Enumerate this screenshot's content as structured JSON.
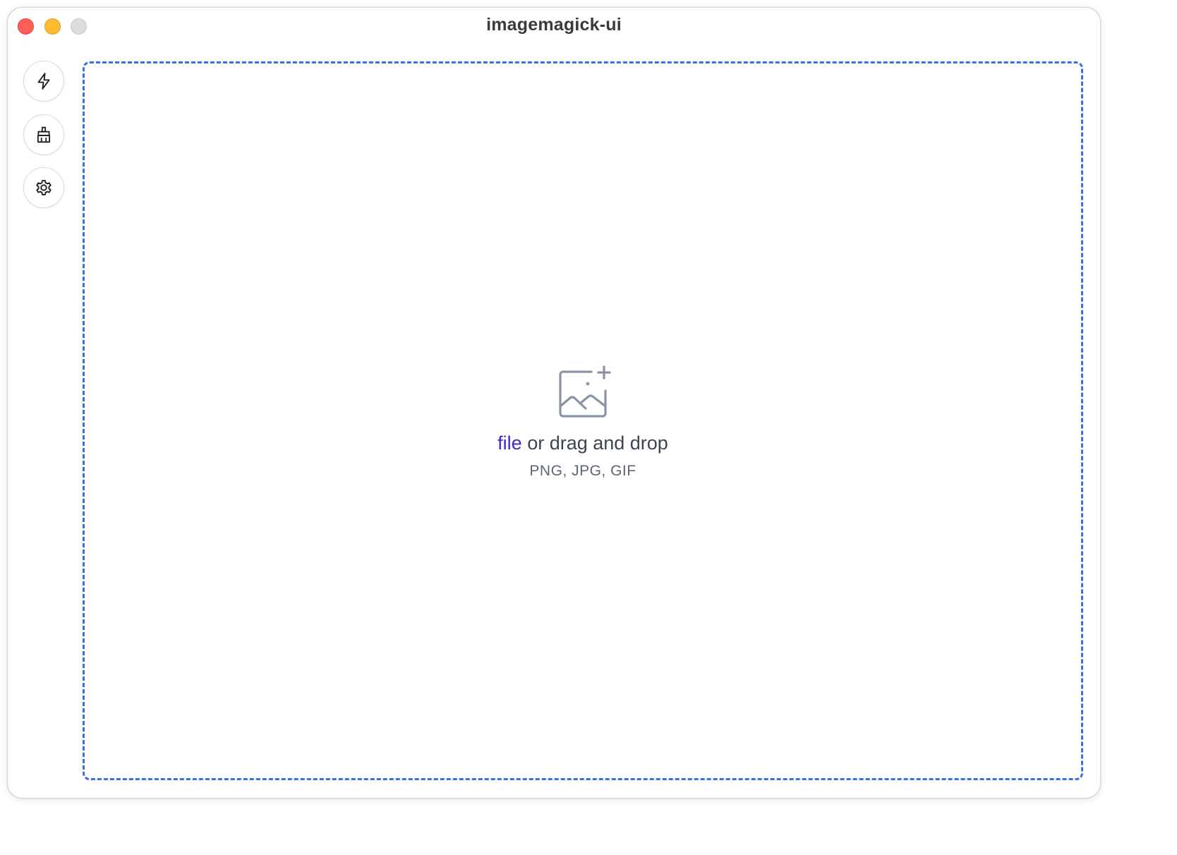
{
  "window": {
    "title": "imagemagick-ui"
  },
  "sidebar": {
    "buttons": [
      {
        "icon": "lightning-bolt-icon"
      },
      {
        "icon": "broom-icon"
      },
      {
        "icon": "gear-icon"
      }
    ]
  },
  "dropzone": {
    "link_label": "file",
    "prompt_rest": " or drag and drop",
    "formats": "PNG, JPG, GIF",
    "icon": "image-add-icon",
    "border_color": "#3b6ee6",
    "link_color": "#4527c9"
  }
}
